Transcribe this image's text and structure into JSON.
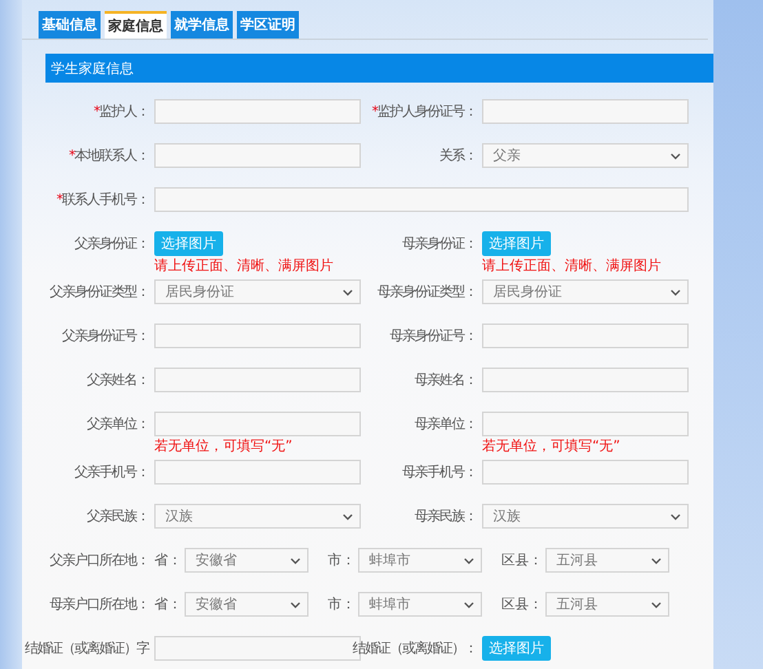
{
  "tabs": [
    {
      "label": "基础信息",
      "selected": false
    },
    {
      "label": "家庭信息",
      "selected": true
    },
    {
      "label": "就学信息",
      "selected": false
    },
    {
      "label": "学区证明",
      "selected": false
    }
  ],
  "section_title": "学生家庭信息",
  "rows": [
    {
      "cells": [
        {
          "kind": "input",
          "label": "监护人：",
          "required_mark": "*"
        },
        {
          "kind": "input",
          "label": "监护人身份证号：",
          "required_mark": "*"
        }
      ]
    },
    {
      "cells": [
        {
          "kind": "input",
          "label": "本地联系人：",
          "required_mark": "*"
        },
        {
          "kind": "select",
          "label": "关系：",
          "value": "父亲"
        }
      ]
    },
    {
      "cells": [
        {
          "kind": "wide_input",
          "label": "联系人手机号：",
          "required_mark": "*"
        }
      ]
    },
    {
      "cells": [
        {
          "kind": "upload",
          "label": "父亲身份证：",
          "button": "选择图片",
          "hint": "请上传正面、清晰、满屏图片"
        },
        {
          "kind": "upload",
          "label": "母亲身份证：",
          "button": "选择图片",
          "hint": "请上传正面、清晰、满屏图片"
        }
      ]
    },
    {
      "cells": [
        {
          "kind": "select",
          "label": "父亲身份证类型：",
          "value": "居民身份证"
        },
        {
          "kind": "select",
          "label": "母亲身份证类型：",
          "value": "居民身份证"
        }
      ]
    },
    {
      "cells": [
        {
          "kind": "input",
          "label": "父亲身份证号："
        },
        {
          "kind": "input",
          "label": "母亲身份证号："
        }
      ]
    },
    {
      "cells": [
        {
          "kind": "input",
          "label": "父亲姓名："
        },
        {
          "kind": "input",
          "label": "母亲姓名："
        }
      ]
    },
    {
      "cells": [
        {
          "kind": "input",
          "label": "父亲单位：",
          "hint": "若无单位，可填写“无”"
        },
        {
          "kind": "input",
          "label": "母亲单位：",
          "hint": "若无单位，可填写“无”"
        }
      ]
    },
    {
      "cells": [
        {
          "kind": "input",
          "label": "父亲手机号："
        },
        {
          "kind": "input",
          "label": "母亲手机号："
        }
      ]
    },
    {
      "cells": [
        {
          "kind": "select",
          "label": "父亲民族：",
          "value": "汉族"
        },
        {
          "kind": "select",
          "label": "母亲民族：",
          "value": "汉族"
        }
      ]
    },
    {
      "cells": [
        {
          "kind": "address",
          "label": "父亲户口所在地：",
          "parts": [
            {
              "label": "省：",
              "value": "安徽省"
            },
            {
              "label": "市：",
              "value": "蚌埠市"
            },
            {
              "label": "区县：",
              "value": "五河县"
            }
          ]
        }
      ]
    },
    {
      "cells": [
        {
          "kind": "address",
          "label": "母亲户口所在地：",
          "parts": [
            {
              "label": "省：",
              "value": "安徽省"
            },
            {
              "label": "市：",
              "value": "蚌埠市"
            },
            {
              "label": "区县：",
              "value": "五河县"
            }
          ]
        }
      ]
    },
    {
      "cells": [
        {
          "kind": "input",
          "label": "结婚证（或离婚证）字"
        },
        {
          "kind": "upload",
          "label": "结婚证（或离婚证）：",
          "button": "选择图片"
        }
      ]
    }
  ]
}
